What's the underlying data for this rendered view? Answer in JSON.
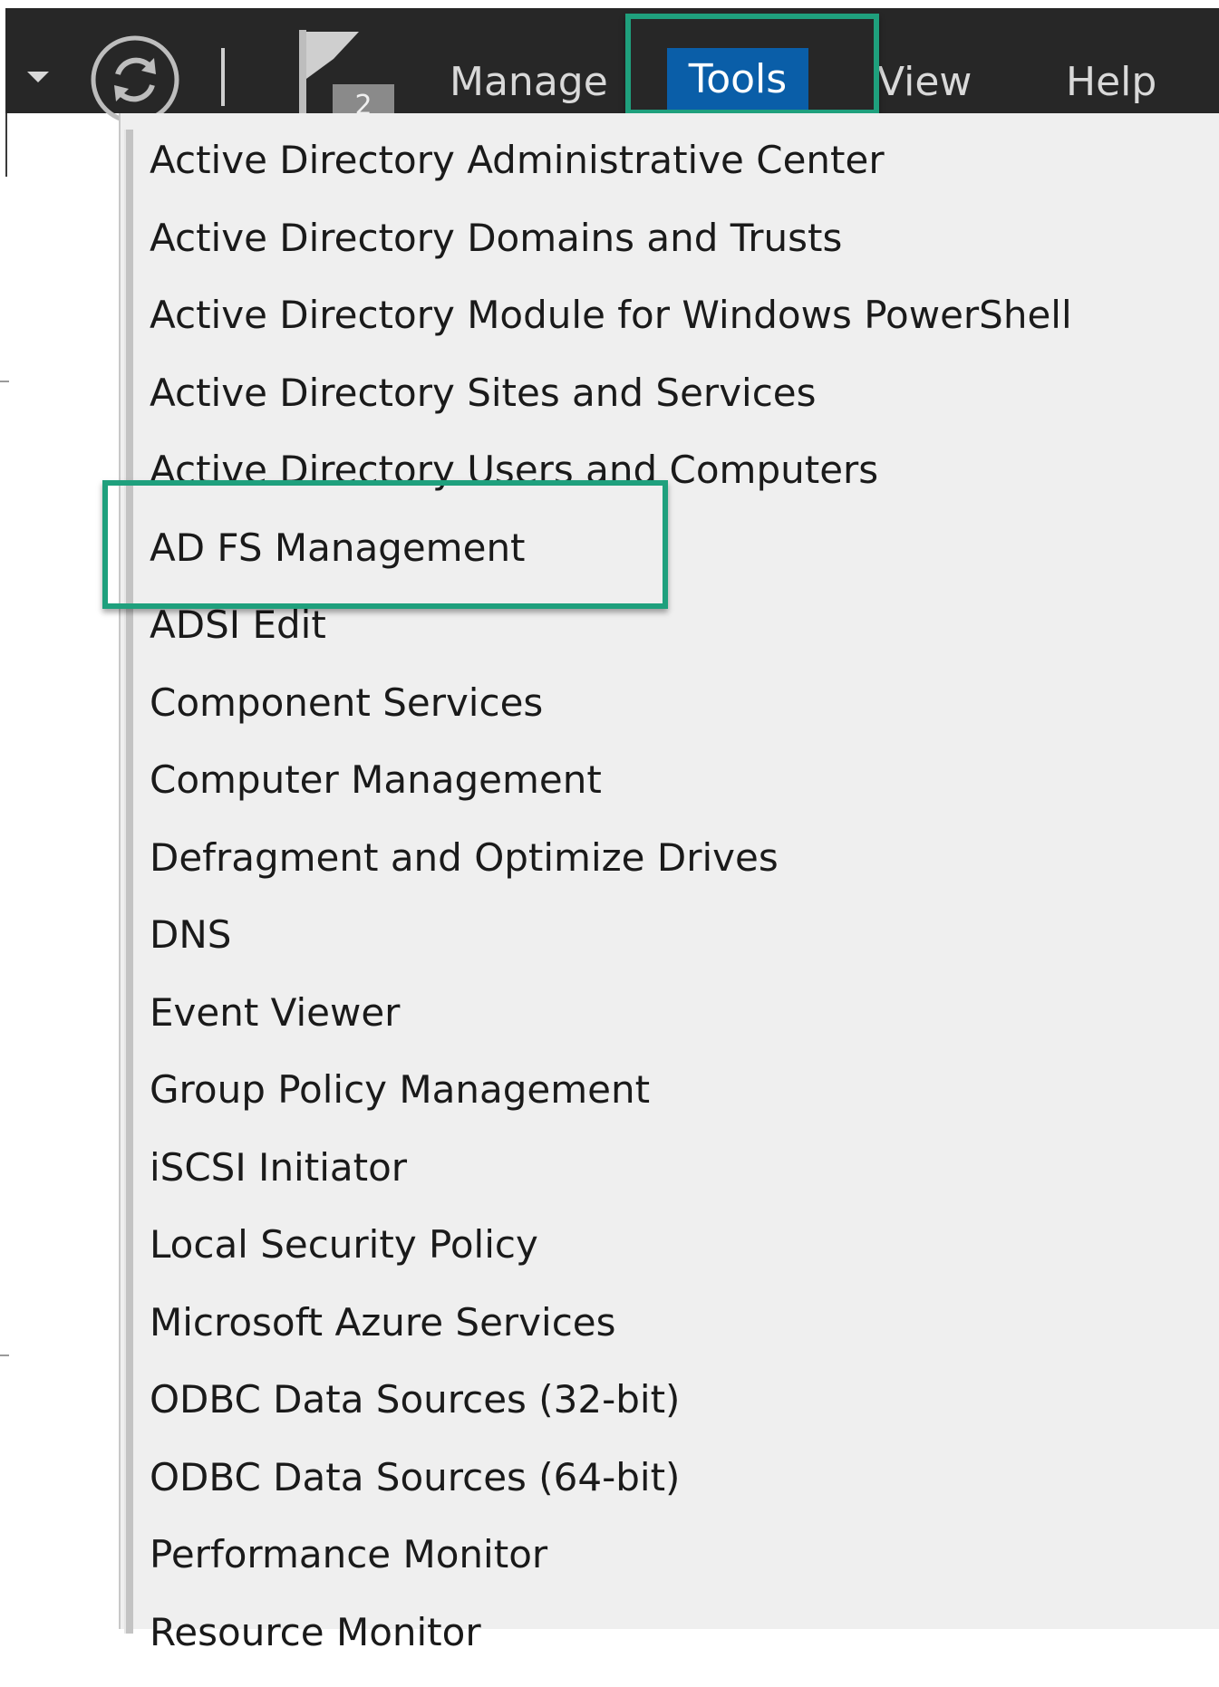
{
  "colors": {
    "toolbar_bg": "#272727",
    "menu_bg": "#efefef",
    "active_menu": "#0a5ea8",
    "highlight": "#1fa07d"
  },
  "toolbar": {
    "dropdown_icon": "caret-down-icon",
    "refresh_icon": "refresh-icon",
    "flag_icon": "notification-flag-icon",
    "flag_badge": "2",
    "menus": {
      "manage": "Manage",
      "tools": "Tools",
      "view": "View",
      "help": "Help"
    }
  },
  "tools_menu": {
    "items": [
      "Active Directory Administrative Center",
      "Active Directory Domains and Trusts",
      "Active Directory Module for Windows PowerShell",
      "Active Directory Sites and Services",
      "Active Directory Users and Computers",
      "AD FS Management",
      "ADSI Edit",
      "Component Services",
      "Computer Management",
      "Defragment and Optimize Drives",
      "DNS",
      "Event Viewer",
      "Group Policy Management",
      "iSCSI Initiator",
      "Local Security Policy",
      "Microsoft Azure Services",
      "ODBC Data Sources (32-bit)",
      "ODBC Data Sources (64-bit)",
      "Performance Monitor",
      "Resource Monitor"
    ]
  }
}
